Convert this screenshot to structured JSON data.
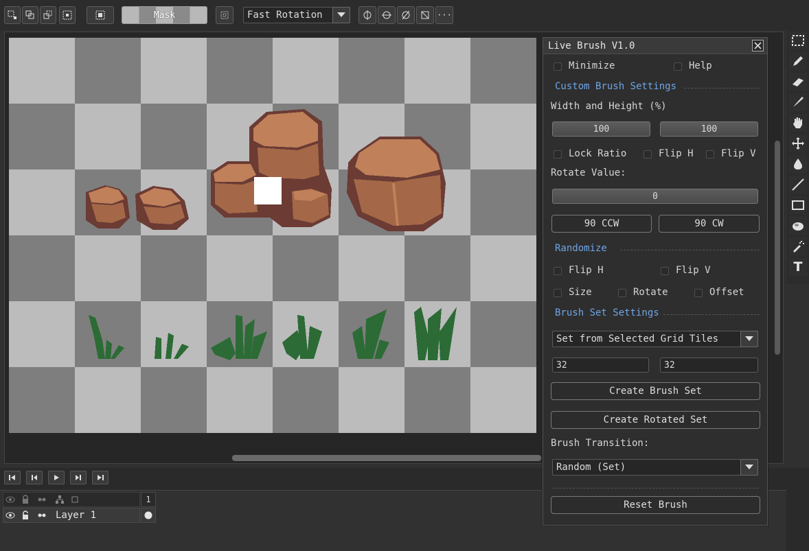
{
  "toolbar": {
    "mask_label": "Mask",
    "rotation_mode": "Fast Rotation",
    "more_label": "···"
  },
  "tools": [
    "marquee-icon",
    "pencil-icon",
    "eraser-icon",
    "brush-icon",
    "hand-icon",
    "move-icon",
    "fill-icon",
    "line-icon",
    "rectangle-icon",
    "ellipse-icon",
    "spray-icon",
    "text-icon"
  ],
  "tools_text_glyph": "T",
  "panel": {
    "title": "Live Brush V1.0",
    "minimize_label": "Minimize",
    "help_label": "Help",
    "custom_section": "Custom Brush Settings",
    "width_height_label": "Width and Height (%)",
    "width_value": "100",
    "height_value": "100",
    "lock_ratio_label": "Lock Ratio",
    "flip_h_label": "Flip H",
    "flip_v_label": "Flip V",
    "rotate_label": "Rotate Value:",
    "rotate_value": "0",
    "ccw_label": "90 CCW",
    "cw_label": "90 CW",
    "randomize_section": "Randomize",
    "rand_flip_h_label": "Flip H",
    "rand_flip_v_label": "Flip V",
    "rand_size_label": "Size",
    "rand_rotate_label": "Rotate",
    "rand_offset_label": "Offset",
    "brushset_section": "Brush Set Settings",
    "set_source": "Set from Selected Grid Tiles",
    "grid_w": "32",
    "grid_h": "32",
    "create_set_label": "Create Brush Set",
    "create_rotated_label": "Create Rotated Set",
    "transition_label": "Brush Transition:",
    "transition_value": "Random (Set)",
    "reset_label": "Reset Brush"
  },
  "timeline": {
    "frame_number": "1",
    "layer_name": "Layer 1"
  },
  "colors": {
    "accent": "#6fa5e6",
    "rock_light": "#c0805a",
    "rock_mid": "#a46848",
    "rock_dark": "#6b3b34",
    "grass": "#2c6b35"
  }
}
